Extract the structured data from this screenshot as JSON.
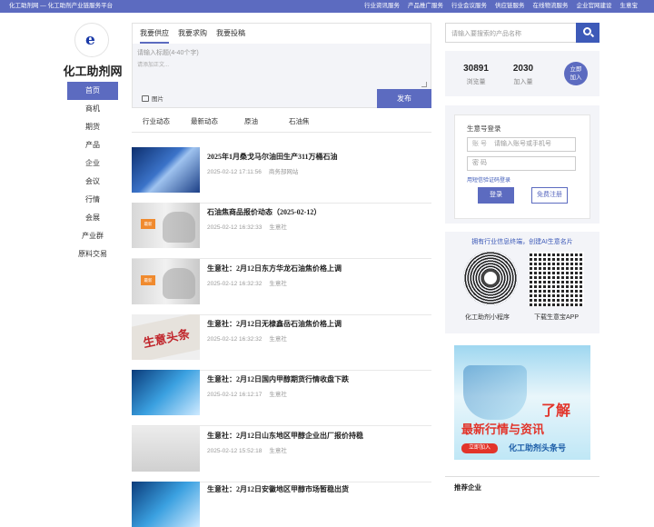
{
  "topbar": {
    "left": "化工助剂网 — 化工助剂产业链服务平台",
    "links": [
      "行业资讯服务",
      "产品推广服务",
      "行业会议服务",
      "供应链服务",
      "在线物流服务",
      "企业官网建设",
      "生意宝"
    ]
  },
  "site": {
    "name": "化工助剂网",
    "logo_letter": "e"
  },
  "nav": [
    "首页",
    "商机",
    "期货",
    "产品",
    "企业",
    "会议",
    "行情",
    "会展",
    "产业群",
    "原料交易"
  ],
  "post": {
    "tabs": [
      "我要供应",
      "我要求购",
      "我要投稿"
    ],
    "title_placeholder": "请输入标题(4-40个字)",
    "content_placeholder": "请添加正文...",
    "image_label": "图片",
    "publish": "发布"
  },
  "content_tabs": [
    "行业动态",
    "最新动态",
    "原油",
    "石油焦"
  ],
  "news": [
    {
      "title": "2025年1月桑戈马尔油田生产311万桶石油",
      "date": "2025-02-12 17:11:56",
      "source": "商务部网站",
      "tag": ""
    },
    {
      "title": "石油焦商品报价动态（2025-02-12）",
      "date": "2025-02-12 16:32:33",
      "source": "生意社",
      "tag": "最新"
    },
    {
      "title": "生意社：2月12日东方华龙石油焦价格上调",
      "date": "2025-02-12 16:32:32",
      "source": "生意社",
      "tag": "最新"
    },
    {
      "title": "生意社：2月12日无棣鑫岳石油焦价格上调",
      "date": "2025-02-12 16:32:32",
      "source": "生意社",
      "tag": "生意头条"
    },
    {
      "title": "生意社：2月12日国内甲醇期货行情收盘下跌",
      "date": "2025-02-12 16:12:17",
      "source": "生意社",
      "tag": ""
    },
    {
      "title": "生意社：2月12日山东地区甲醇企业出厂报价持稳",
      "date": "2025-02-12 15:52:18",
      "source": "生意社",
      "tag": ""
    },
    {
      "title": "生意社：2月12日安徽地区甲醇市场暂稳出货",
      "date": "",
      "source": "",
      "tag": ""
    }
  ],
  "search": {
    "placeholder": "请输入要搜索的产品名称"
  },
  "stats": {
    "views": "30891",
    "views_label": "浏览量",
    "joins": "2030",
    "joins_label": "加入量",
    "join_btn_1": "立即",
    "join_btn_2": "加入"
  },
  "login": {
    "heading": "生意号登录",
    "account_label": "账 号",
    "account_placeholder": "请输入账号或手机号",
    "password_placeholder": "密 码",
    "sms_link": "用短信验证码登录",
    "login_btn": "登录",
    "register_btn": "免费注册"
  },
  "qr": {
    "title": "拥有行业信息终端，创建AI生意名片",
    "mini_caption": "化工助剂小程序",
    "app_caption": "下载生意宝APP"
  },
  "ad": {
    "big": "了解",
    "mid": "最新行情与资讯",
    "join": "立即加入",
    "brand": "化工助剂头条号"
  },
  "recommend": {
    "title": "推荐企业"
  }
}
